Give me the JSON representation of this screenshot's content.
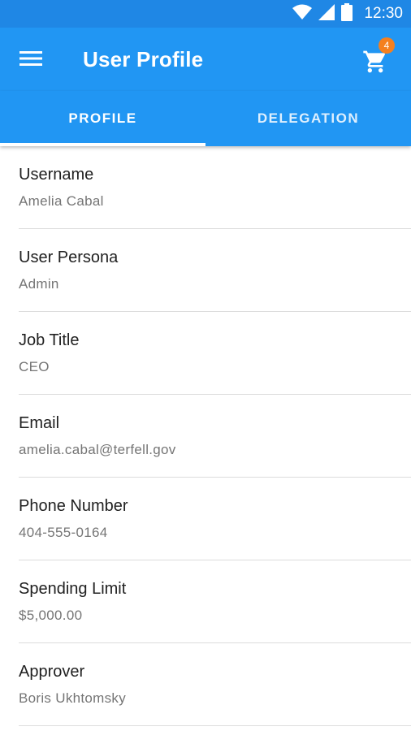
{
  "status_bar": {
    "time": "12:30",
    "icons": [
      "wifi-icon",
      "signal-icon",
      "battery-icon"
    ]
  },
  "app_bar": {
    "title": "User Profile",
    "menu_icon": "menu-icon",
    "cart_icon": "cart-icon",
    "cart_badge": "4",
    "colors": {
      "primary": "#2196f3",
      "status": "#1f87e5",
      "badge": "#f4801f"
    }
  },
  "tabs": [
    {
      "label": "PROFILE",
      "selected": true
    },
    {
      "label": "DELEGATION",
      "selected": false
    }
  ],
  "fields": [
    {
      "label": "Username",
      "value": "Amelia Cabal"
    },
    {
      "label": "User Persona",
      "value": "Admin"
    },
    {
      "label": "Job Title",
      "value": "CEO"
    },
    {
      "label": "Email",
      "value": "amelia.cabal@terfell.gov"
    },
    {
      "label": "Phone Number",
      "value": "404-555-0164"
    },
    {
      "label": "Spending Limit",
      "value": "$5,000.00"
    },
    {
      "label": "Approver",
      "value": "Boris Ukhtomsky"
    }
  ]
}
